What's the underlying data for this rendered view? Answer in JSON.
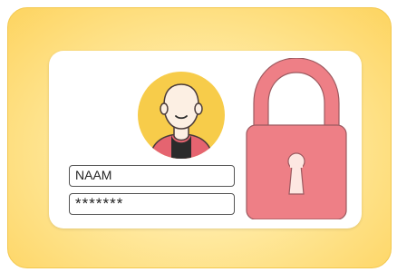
{
  "illustration": {
    "name_field": {
      "value": "NAAM"
    },
    "password_field": {
      "value": "*******"
    },
    "icons": [
      "avatar-icon",
      "padlock-icon"
    ],
    "colors": {
      "background_outer": "#fdd460",
      "card": "#ffffff",
      "avatar_circle": "#f7cc4a",
      "padlock": "#ee7f86",
      "keyhole": "#fde7e2",
      "shirt": "#e56470"
    }
  }
}
